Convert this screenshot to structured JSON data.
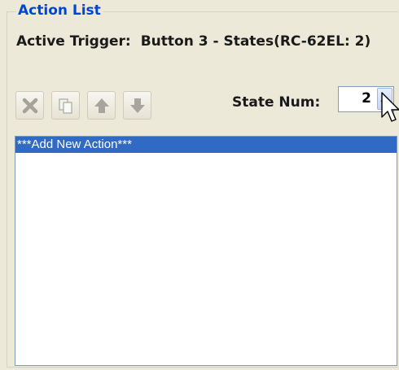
{
  "group": {
    "title": "Action List"
  },
  "trigger": {
    "label": "Active Trigger:",
    "value": "Button 3 - States(RC-62EL: 2)"
  },
  "toolbar": {
    "buttons": [
      {
        "icon": "delete-x-icon",
        "enabled": false
      },
      {
        "icon": "copy-icon",
        "enabled": false
      },
      {
        "icon": "arrow-up-icon",
        "enabled": false
      },
      {
        "icon": "arrow-down-icon",
        "enabled": false
      }
    ]
  },
  "state": {
    "label": "State Num:",
    "value": "2"
  },
  "actions": {
    "items": [
      {
        "label": "***Add New Action***",
        "selected": true
      }
    ]
  },
  "colors": {
    "selection": "#316ac5",
    "group_title": "#0046d5",
    "panel_bg": "#ece9d8"
  }
}
